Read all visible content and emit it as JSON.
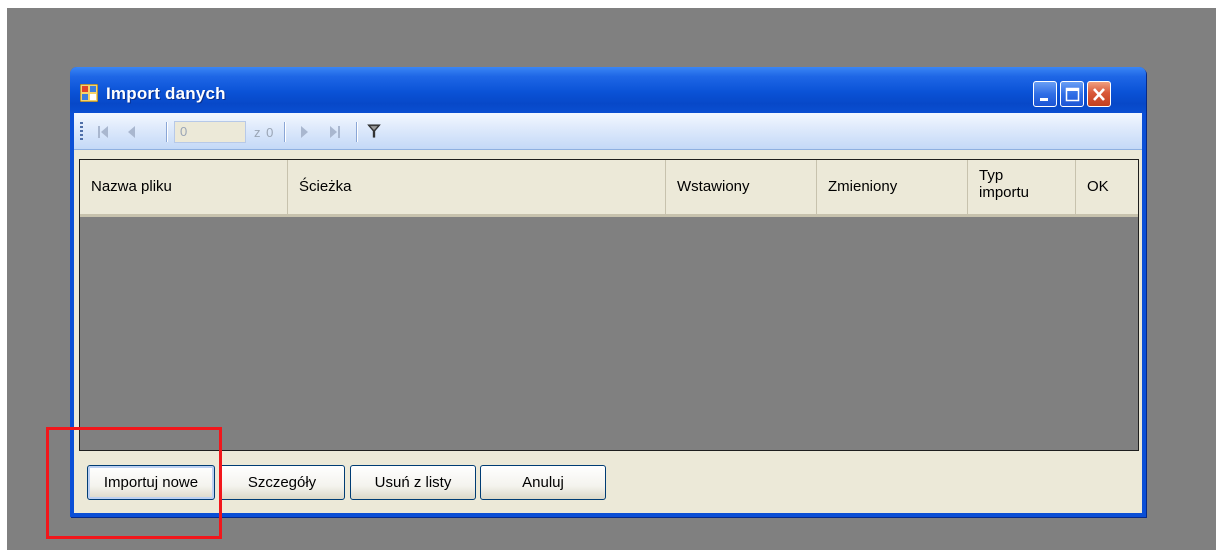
{
  "window": {
    "title": "Import danych",
    "icon": "app-window-icon",
    "controls": [
      "minimize-icon",
      "maximize-icon",
      "close-icon"
    ]
  },
  "navigator": {
    "position_value": "0",
    "count_label": "z 0",
    "icons": [
      "first-record-icon",
      "previous-record-icon",
      "next-record-icon",
      "last-record-icon",
      "filter-icon"
    ]
  },
  "grid": {
    "columns": [
      "Nazwa pliku",
      "Ścieżka",
      "Wstawiony",
      "Zmieniony",
      "Typ importu",
      "OK"
    ],
    "rows": []
  },
  "buttons": {
    "import_new": "Importuj nowe",
    "details": "Szczegóły",
    "remove_from_list": "Usuń z listy",
    "cancel": "Anuluj"
  },
  "colors": {
    "desktop": "#808080",
    "titlebar": "#0a52d6",
    "highlight": "#f2161b"
  }
}
